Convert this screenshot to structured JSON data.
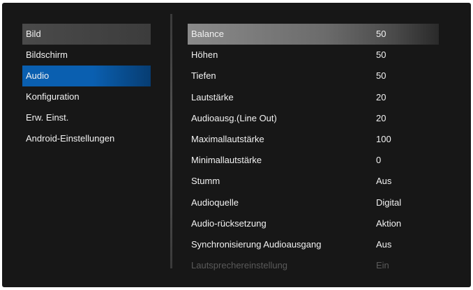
{
  "sidebar": {
    "items": [
      {
        "label": "Bild"
      },
      {
        "label": "Bildschirm"
      },
      {
        "label": "Audio"
      },
      {
        "label": "Konfiguration"
      },
      {
        "label": "Erw. Einst."
      },
      {
        "label": "Android-Einstellungen"
      }
    ]
  },
  "panel": {
    "rows": [
      {
        "label": "Balance",
        "value": "50"
      },
      {
        "label": "Höhen",
        "value": "50"
      },
      {
        "label": "Tiefen",
        "value": "50"
      },
      {
        "label": "Lautstärke",
        "value": "20"
      },
      {
        "label": "Audioausg.(Line Out)",
        "value": "20"
      },
      {
        "label": "Maximallautstärke",
        "value": "100"
      },
      {
        "label": "Minimallautstärke",
        "value": "0"
      },
      {
        "label": "Stumm",
        "value": "Aus"
      },
      {
        "label": "Audioquelle",
        "value": "Digital"
      },
      {
        "label": "Audio-rücksetzung",
        "value": "Aktion"
      },
      {
        "label": "Synchronisierung Audioausgang",
        "value": "Aus"
      },
      {
        "label": "Lautsprechereinstellung",
        "value": "Ein"
      }
    ]
  },
  "colors": {
    "background": "#171717",
    "selected_accent": "#0a5fb0",
    "text": "#f2f2f2",
    "disabled_text": "#5a5a5a"
  }
}
